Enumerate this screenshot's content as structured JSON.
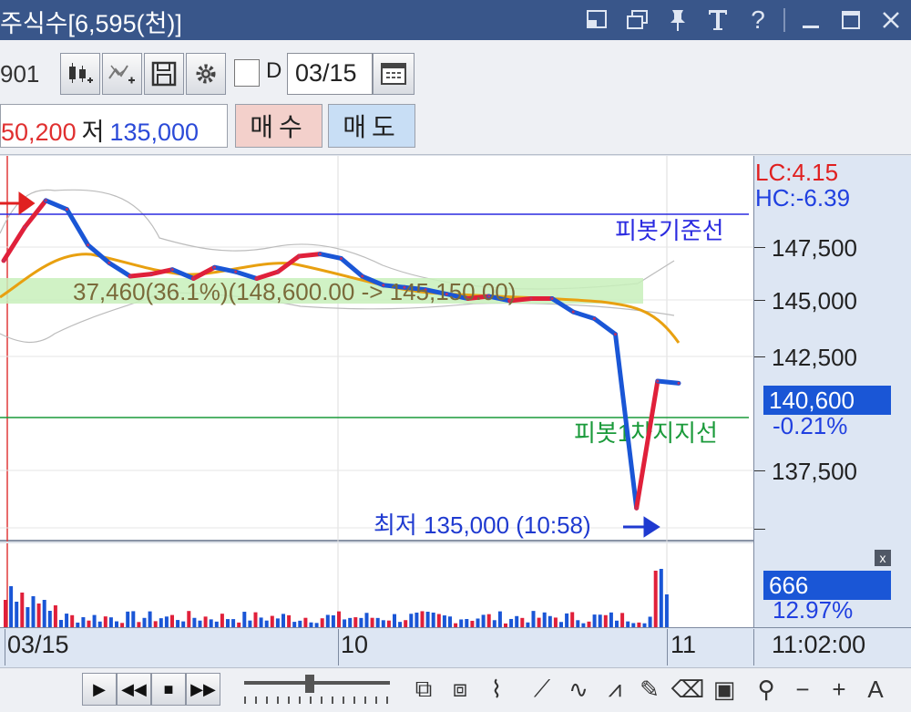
{
  "window": {
    "title": "주식수[6,595(천)]",
    "icons": [
      "restore-layout-icon",
      "cascade-window-icon",
      "pin-icon",
      "text-icon",
      "help-icon",
      "minimize-icon",
      "maximize-icon",
      "close-icon"
    ]
  },
  "toolbar": {
    "code_fragment": "901",
    "checkbox_label": "D",
    "date_value": "03/15",
    "high_value": "50,200",
    "low_label": "저",
    "low_value": "135,000",
    "buy_label": "매수",
    "sell_label": "매도"
  },
  "overlay": {
    "lc": "LC:4.15",
    "hc": "HC:-6.39",
    "pivot_base_label": "피봇기준선",
    "pivot_support_label": "피봇1차지지선",
    "range_annotation": "37,460(36.1%)(148,600.00 -> 145,150.00)",
    "low_annotation": "최저 135,000 (10:58)",
    "current_price": "140,600",
    "current_change": "-0.21%",
    "volume_value": "666",
    "volume_pct": "12.97%",
    "volume_close": "x"
  },
  "y_axis": {
    "ticks": [
      "147,500",
      "145,000",
      "142,500",
      "137,500"
    ]
  },
  "x_axis": {
    "labels": [
      "03/15",
      "10",
      "11"
    ],
    "time": "11:02:00"
  },
  "chart_data": {
    "type": "line",
    "ylim": [
      133500,
      150800
    ],
    "ticks": [
      147500,
      145000,
      142500,
      137500
    ],
    "pivot_base": 148500,
    "pivot_support_1": 140500,
    "current_price": 140600,
    "low": 135000,
    "series": [
      {
        "values": [
          146100,
          147600,
          148800,
          148400,
          146800,
          146000,
          145400,
          145500,
          145700,
          145300,
          145800,
          145600,
          145300,
          145600,
          146300,
          146400,
          146200,
          145400,
          145000,
          144900,
          144800,
          144600,
          144400,
          144500,
          144300,
          144400,
          144400,
          143800,
          143500,
          142800,
          135000,
          140700,
          140600
        ]
      }
    ]
  }
}
